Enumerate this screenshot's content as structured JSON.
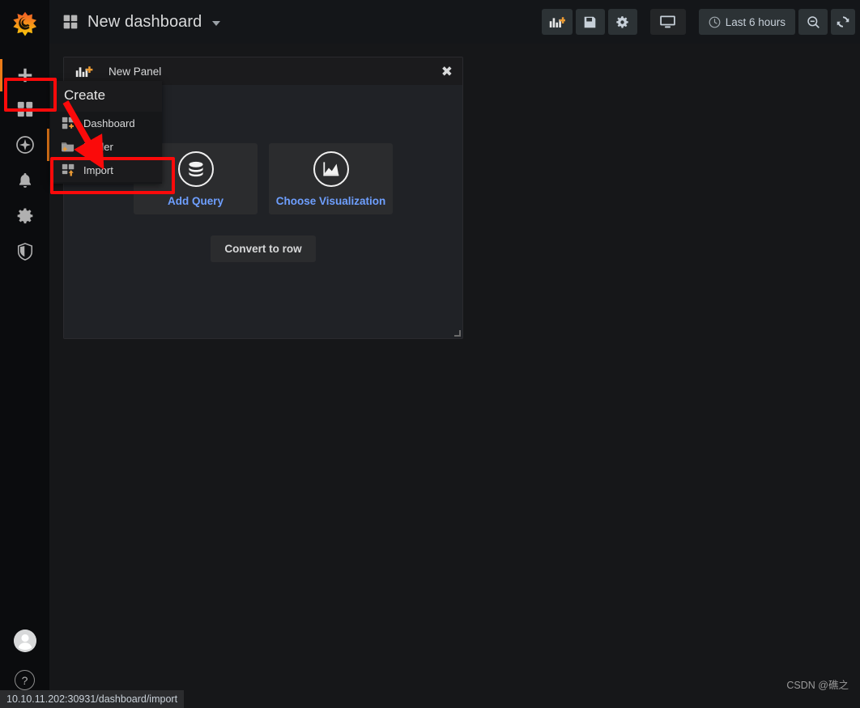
{
  "app": {
    "logo_icon": "grafana-logo-icon",
    "background": "#161719",
    "accent_color": "#eb7b18"
  },
  "sidebar": {
    "items": [
      {
        "name": "create",
        "icon": "plus-icon",
        "label": "Create"
      },
      {
        "name": "dashboards",
        "icon": "dashboards-grid-icon",
        "label": "Dashboards"
      },
      {
        "name": "explore",
        "icon": "compass-icon",
        "label": "Explore"
      },
      {
        "name": "alerting",
        "icon": "bell-icon",
        "label": "Alerting"
      },
      {
        "name": "configuration",
        "icon": "gear-icon",
        "label": "Configuration"
      },
      {
        "name": "server-admin",
        "icon": "shield-icon",
        "label": "Server Admin"
      }
    ],
    "bottom": [
      {
        "name": "user-profile",
        "icon": "user-avatar-icon",
        "label": "User"
      },
      {
        "name": "help",
        "icon": "question-mark-icon",
        "label": "?"
      }
    ]
  },
  "topnav": {
    "dashboard_icon": "dashboard-grid-icon",
    "title": "New dashboard",
    "caret": "chevron-down-icon",
    "toolbar": [
      {
        "name": "add-panel-button",
        "icon": "add-panel-icon",
        "label": ""
      },
      {
        "name": "save-dashboard-button",
        "icon": "save-floppy-icon",
        "label": ""
      },
      {
        "name": "dashboard-settings-button",
        "icon": "gear-icon",
        "label": ""
      },
      {
        "name": "tv-mode-button",
        "icon": "monitor-icon",
        "label": ""
      },
      {
        "name": "time-range-picker",
        "icon": "clock-icon",
        "label": "Last 6 hours"
      },
      {
        "name": "zoom-out-button",
        "icon": "magnifier-minus-icon",
        "label": ""
      },
      {
        "name": "refresh-button",
        "icon": "refresh-icon",
        "label": ""
      }
    ],
    "time_range": "Last 6 hours"
  },
  "panel": {
    "header_icon": "add-panel-icon",
    "title": "New Panel",
    "close_label": "✖",
    "actions": [
      {
        "name": "add-query-button",
        "icon": "database-icon",
        "label": "Add Query"
      },
      {
        "name": "choose-visualization-button",
        "icon": "graph-area-icon",
        "label": "Choose Visualization"
      }
    ],
    "convert_label": "Convert to row"
  },
  "create_menu": {
    "header": "Create",
    "items": [
      {
        "name": "menu-item-dashboard",
        "icon": "dashboard-add-icon",
        "label": "Dashboard",
        "active": false
      },
      {
        "name": "menu-item-folder",
        "icon": "folder-add-icon",
        "label": "Folder",
        "active": false
      },
      {
        "name": "menu-item-import",
        "icon": "import-icon",
        "label": "Import",
        "active": true
      }
    ]
  },
  "annotations": {
    "highlight_color": "#fb0a0a",
    "boxes": [
      "create-plus-button",
      "import-menu-item"
    ],
    "arrow": "red-arrow-pointing-to-import"
  },
  "statusbar": {
    "url": "10.10.11.202:30931/dashboard/import"
  },
  "watermark": {
    "text": "CSDN @礁之"
  }
}
